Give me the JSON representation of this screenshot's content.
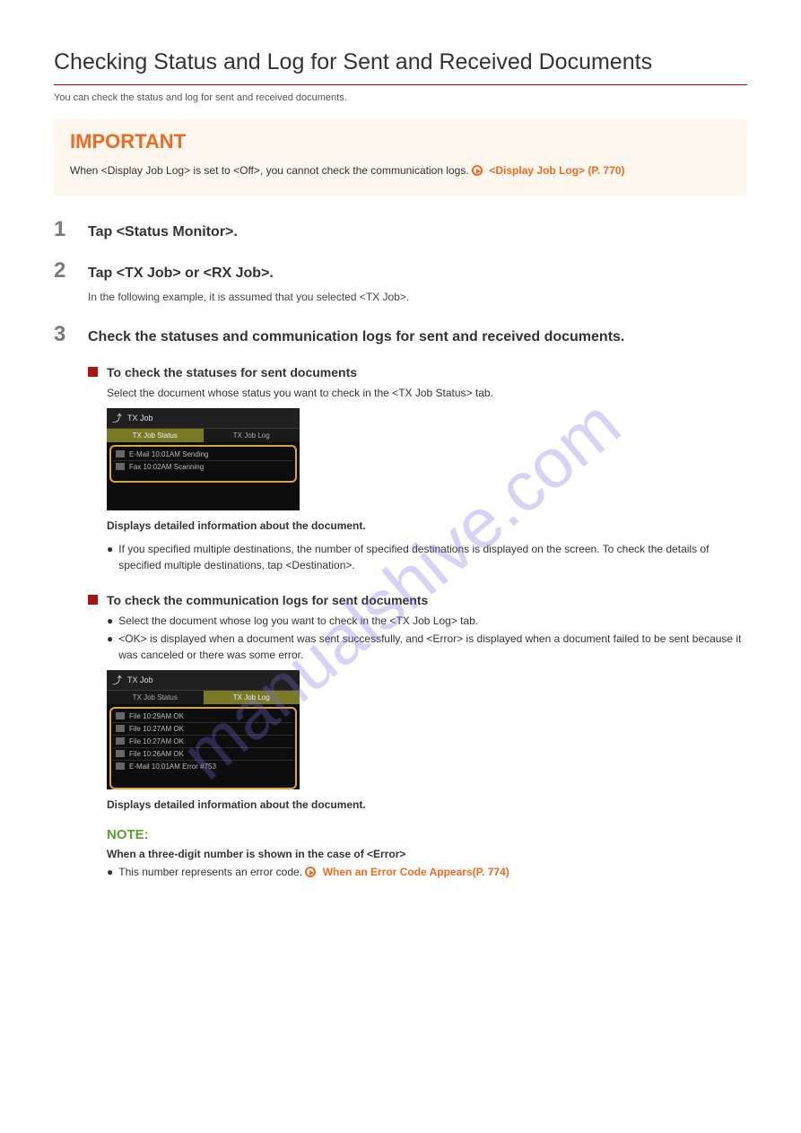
{
  "watermark": "manualshive.com",
  "page_title": "Checking Status and Log for Sent and Received Documents",
  "top_desc": "You can check the status and log for sent and received documents.",
  "important": {
    "title": "IMPORTANT",
    "body_prefix": "When <Display Job Log> is set to <Off>, you cannot check the communication logs. ",
    "link_text": "<Display Job Log> (P. 770)"
  },
  "steps": {
    "one": {
      "num": "1",
      "text": "Tap <Status Monitor>."
    },
    "two": {
      "num": "2",
      "text": "Tap <TX Job> or <RX Job>.",
      "note": "In the following example, it is assumed that you selected <TX Job>."
    },
    "three": {
      "num": "3",
      "text": "Check the statuses and communication logs for sent and received documents."
    }
  },
  "tabs": {
    "status": {
      "heading": "To check the statuses for sent documents",
      "desc": "Select the document whose status you want to check in the <TX Job Status> tab.",
      "insight_prefix": "Displays detailed information about the document.",
      "insight_bullet": "If you specified multiple destinations, the number of specified destinations is displayed on the screen. To check the details of specified multiple destinations, tap <Destination>."
    },
    "log": {
      "heading": "To check the communication logs for sent documents",
      "desc_1": "Select the document whose log you want to check in the <TX Job Log> tab.",
      "desc_2": "<OK> is displayed when a document was sent successfully, and <Error> is displayed when a document failed to be sent because it was canceled or there was some error.",
      "insight": "Displays detailed information about the document."
    }
  },
  "device_shot_1": {
    "title": "TX Job",
    "tab_active": "TX Job Status",
    "tab_other": "TX Job Log",
    "items": [
      "E-Mail 10:01AM Sending",
      "Fax 10:02AM Scanning"
    ]
  },
  "device_shot_2": {
    "title": "TX Job",
    "tab_active": "TX Job Log",
    "tab_other": "TX Job Status",
    "items": [
      "File 10:29AM OK",
      "File 10:27AM OK",
      "File 10:27AM OK",
      "File 10:26AM OK",
      "E-Mail 10:01AM Error #753"
    ]
  },
  "note_block": {
    "title": "NOTE:",
    "subtitle": "When a three-digit number is shown in the case of <Error>",
    "bullet_prefix": "This number represents an error code. ",
    "bullet_link": "When an Error Code Appears(P. 774)"
  }
}
